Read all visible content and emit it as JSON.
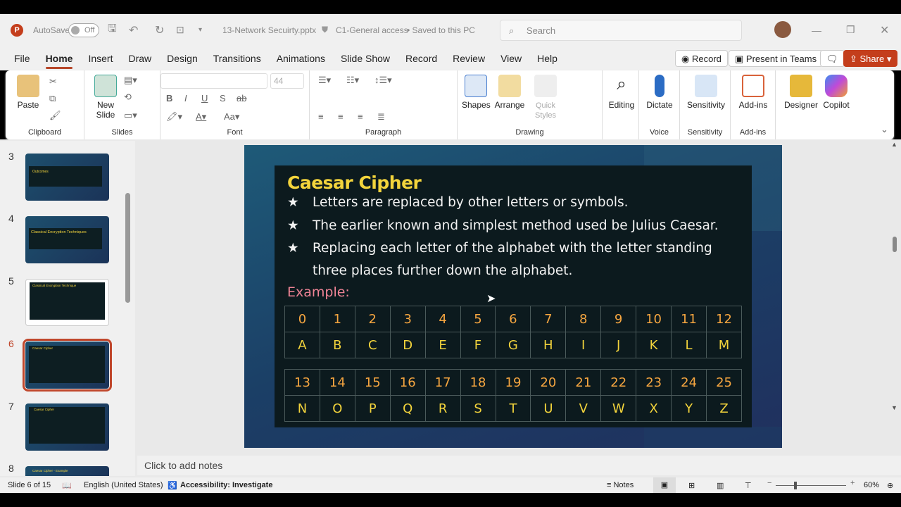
{
  "titlebar": {
    "autosave": "AutoSave",
    "autosave_state": "Off",
    "filename": "13-Network Secuirty.pptx",
    "sensitivity": "C1-General access",
    "saved": "• Saved to this PC",
    "search_placeholder": "Search"
  },
  "tabs": [
    "File",
    "Home",
    "Insert",
    "Draw",
    "Design",
    "Transitions",
    "Animations",
    "Slide Show",
    "Record",
    "Review",
    "View",
    "Help"
  ],
  "tab_actions": {
    "record": "Record",
    "present": "Present in Teams",
    "share": "Share"
  },
  "ribbon": {
    "clipboard": {
      "label": "Clipboard",
      "paste": "Paste"
    },
    "slides": {
      "label": "Slides",
      "new_slide": "New Slide"
    },
    "font": {
      "label": "Font",
      "size": "44"
    },
    "paragraph": {
      "label": "Paragraph"
    },
    "drawing": {
      "label": "Drawing",
      "shapes": "Shapes",
      "arrange": "Arrange",
      "quick_styles": "Quick Styles"
    },
    "editing": "Editing",
    "voice": {
      "label": "Voice",
      "dictate": "Dictate"
    },
    "sensitivity": {
      "label": "Sensitivity",
      "btn": "Sensitivity"
    },
    "addins": {
      "label": "Add-ins",
      "btn": "Add-ins"
    },
    "designer": "Designer",
    "copilot": "Copilot"
  },
  "thumbnails": [
    {
      "num": "3",
      "title": "Outcomes"
    },
    {
      "num": "4",
      "title": "Classical Encryption Techniques"
    },
    {
      "num": "5",
      "title": "Classical Encryption Technique"
    },
    {
      "num": "6",
      "title": "Caesar Cipher"
    },
    {
      "num": "7",
      "title": "Caesar Cipher"
    },
    {
      "num": "8",
      "title": "Caesar Cipher - Example"
    }
  ],
  "slide": {
    "title": "Caesar Cipher",
    "bullets": [
      "Letters are replaced by other letters or symbols.",
      "The earlier known and simplest method used be Julius Caesar.",
      "Replacing each letter of the alphabet with the letter standing",
      "three places further down the alphabet."
    ],
    "star": "★",
    "example": "Example:",
    "table1": {
      "nums": [
        "0",
        "1",
        "2",
        "3",
        "4",
        "5",
        "6",
        "7",
        "8",
        "9",
        "10",
        "11",
        "12"
      ],
      "letters": [
        "A",
        "B",
        "C",
        "D",
        "E",
        "F",
        "G",
        "H",
        "I",
        "J",
        "K",
        "L",
        "M"
      ]
    },
    "table2": {
      "nums": [
        "13",
        "14",
        "15",
        "16",
        "17",
        "18",
        "19",
        "20",
        "21",
        "22",
        "23",
        "24",
        "25"
      ],
      "letters": [
        "N",
        "O",
        "P",
        "Q",
        "R",
        "S",
        "T",
        "U",
        "V",
        "W",
        "X",
        "Y",
        "Z"
      ]
    }
  },
  "notes_placeholder": "Click to add notes",
  "status": {
    "slide": "Slide 6 of 15",
    "language": "English (United States)",
    "accessibility": "Accessibility: Investigate",
    "notes": "Notes",
    "zoom": "60%"
  },
  "colors": {
    "accent": "#b7472a",
    "title": "#f3d43c",
    "number": "#f6a640",
    "example": "#f08496"
  }
}
